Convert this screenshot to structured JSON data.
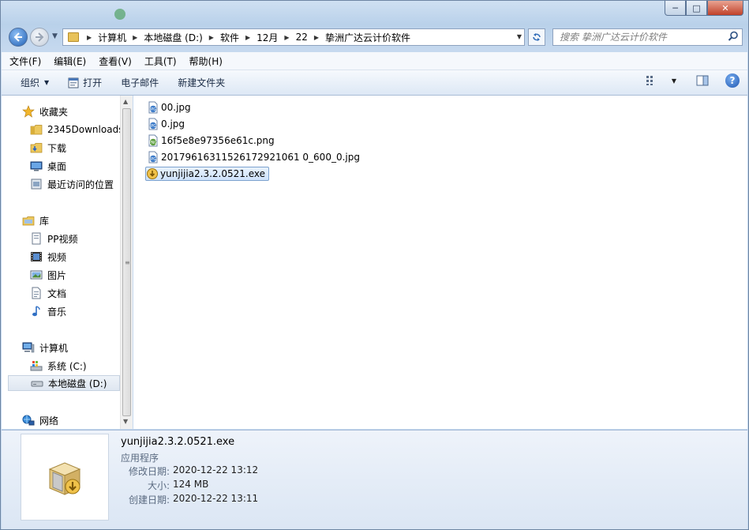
{
  "window": {
    "title_blurred": "",
    "controls": {
      "minimize": "─",
      "maximize": "□",
      "close": "✕"
    }
  },
  "address": {
    "crumbs": [
      "计算机",
      "本地磁盘 (D:)",
      "软件",
      "12月",
      "22",
      "挚洲广达云计价软件"
    ]
  },
  "search": {
    "placeholder": "搜索 挚洲广达云计价软件"
  },
  "menu": [
    "文件(F)",
    "编辑(E)",
    "查看(V)",
    "工具(T)",
    "帮助(H)"
  ],
  "toolbar": {
    "organize": "组织",
    "open": "打开",
    "email": "电子邮件",
    "new_folder": "新建文件夹"
  },
  "nav": {
    "favorites": "收藏夹",
    "downloads_2345": "2345Downloads",
    "downloads": "下载",
    "desktop": "桌面",
    "recent": "最近访问的位置",
    "libraries": "库",
    "pp_video": "PP视频",
    "videos": "视频",
    "pictures": "图片",
    "documents": "文档",
    "music": "音乐",
    "computer": "计算机",
    "drive_c": "系统 (C:)",
    "drive_d": "本地磁盘 (D:)",
    "network": "网络"
  },
  "files": [
    {
      "name": "00.jpg",
      "type": "jpg"
    },
    {
      "name": "0.jpg",
      "type": "jpg"
    },
    {
      "name": "16f5e8e97356e61c.png",
      "type": "png"
    },
    {
      "name": "20179616311526172921061 0_600_0.jpg",
      "type": "jpg"
    },
    {
      "name": "yunjijia2.3.2.0521.exe",
      "type": "exe",
      "selected": true
    }
  ],
  "details": {
    "name": "yunjijia2.3.2.0521.exe",
    "type": "应用程序",
    "modified_label": "修改日期:",
    "modified_value": "2020-12-22 13:12",
    "size_label": "大小:",
    "size_value": "124 MB",
    "created_label": "创建日期:",
    "created_value": "2020-12-22 13:11"
  },
  "colors": {
    "accent": "#3a78c9",
    "selection": "#cfe3fb",
    "jpg_icon": "#3d7cc9",
    "png_icon": "#5c9e3f",
    "exe_icon": "#d4a21e"
  }
}
